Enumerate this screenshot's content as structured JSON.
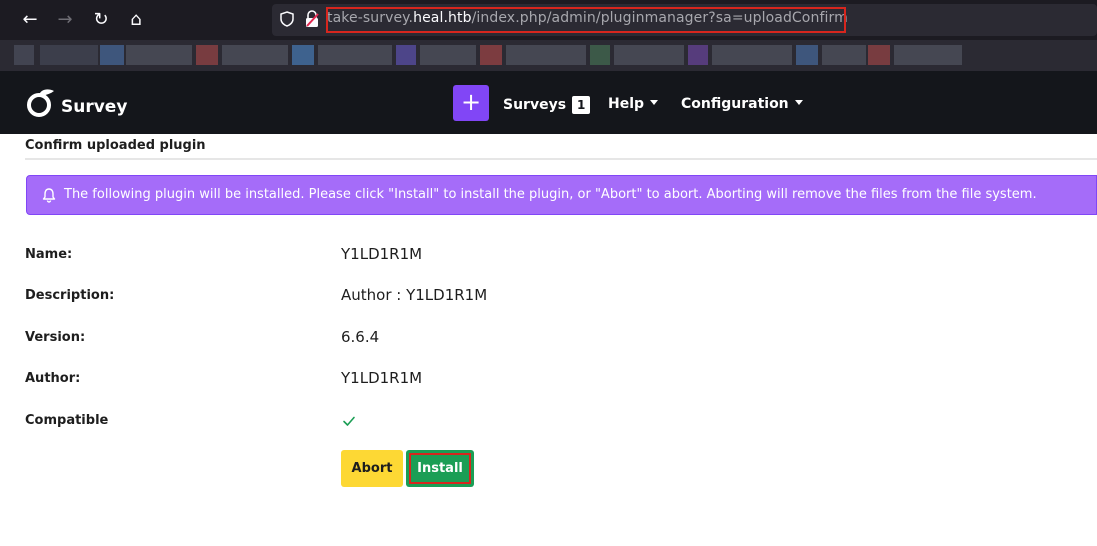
{
  "browser": {
    "back_icon": "←",
    "forward_icon": "→",
    "reload_icon": "↻",
    "home_icon": "⌂",
    "url_host_prefix": "take-survey.",
    "url_host_domain": "heal.htb",
    "url_path": "/index.php/admin/pluginmanager?sa=uploadConfirm"
  },
  "app": {
    "logo_text": "Survey",
    "plus_label": "+",
    "nav": {
      "surveys_label": "Surveys",
      "surveys_count": "1",
      "help_label": "Help",
      "configuration_label": "Configuration"
    }
  },
  "page": {
    "title": "Confirm uploaded plugin",
    "alert_text": "The following plugin will be installed. Please click \"Install\" to install the plugin, or \"Abort\" to abort. Aborting will remove the files from the file system.",
    "details": [
      {
        "label": "Name:",
        "value": "Y1LD1R1M"
      },
      {
        "label": "Description:",
        "value": "Author : Y1LD1R1M"
      },
      {
        "label": "Version:",
        "value": "6.6.4"
      },
      {
        "label": "Author:",
        "value": "Y1LD1R1M"
      },
      {
        "label": "Compatible",
        "value": "✓"
      }
    ],
    "abort_label": "Abort",
    "install_label": "Install"
  },
  "colors": {
    "accent": "#8146f6",
    "alert_bg": "#a56cf9",
    "abort": "#fdd834",
    "install": "#1b9e55",
    "highlight": "#d7261e"
  }
}
